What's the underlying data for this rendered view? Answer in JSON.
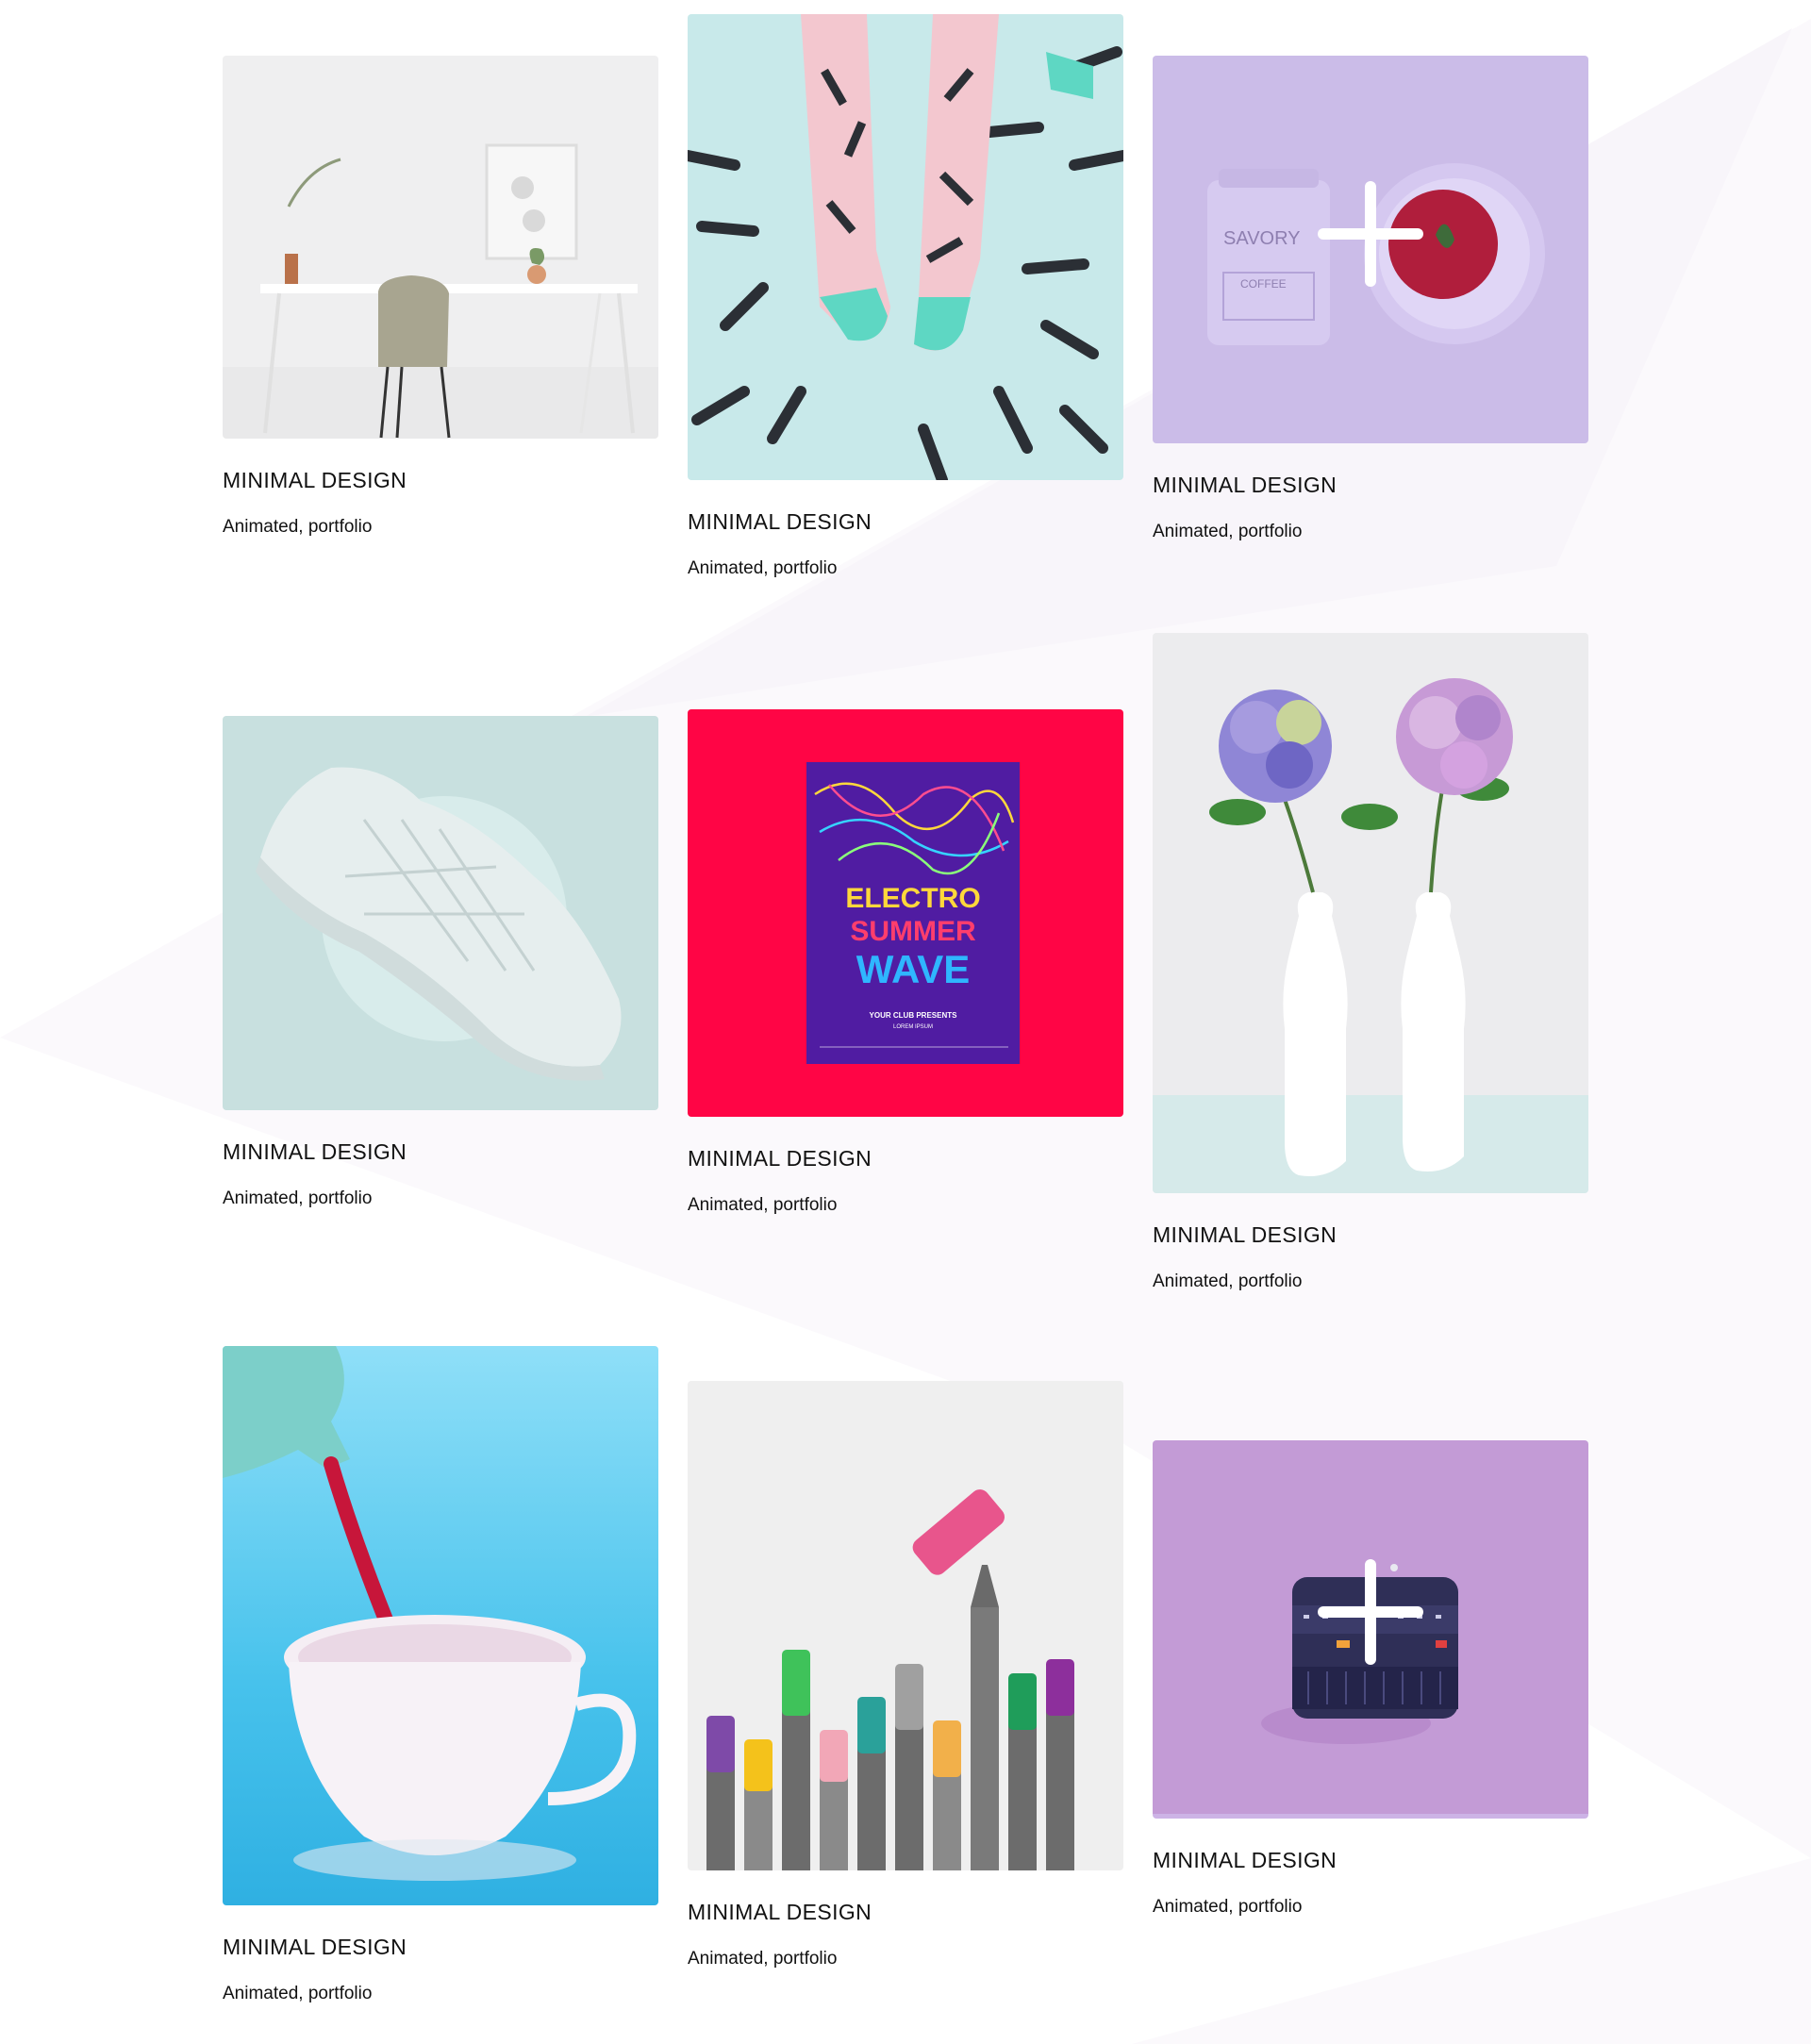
{
  "colors": {
    "page_bg": "#ffffff",
    "shape_bg": "#fbf9fc",
    "text": "#111111"
  },
  "portfolio": {
    "items": [
      {
        "title": "MINIMAL DESIGN",
        "tags": "Animated, portfolio",
        "image": "desk-chair-photo",
        "bg": "#efeff0"
      },
      {
        "title": "MINIMAL DESIGN",
        "tags": "Animated, portfolio",
        "image": "patterned-socks-photo",
        "bg": "#c8e9ea"
      },
      {
        "title": "MINIMAL DESIGN",
        "tags": "Animated, portfolio",
        "image": "coffee-can-and-soup-photo",
        "bg": "#cbbce8",
        "hover_icon": "plus-icon"
      },
      {
        "title": "MINIMAL DESIGN",
        "tags": "Animated, portfolio",
        "image": "white-sneaker-photo",
        "bg": "#c8e0df"
      },
      {
        "title": "MINIMAL DESIGN",
        "tags": "Animated, portfolio",
        "image": "electro-poster-photo",
        "bg": "#ff0545"
      },
      {
        "title": "MINIMAL DESIGN",
        "tags": "Animated, portfolio",
        "image": "hydrangea-vases-photo",
        "bg": "#ececee"
      },
      {
        "title": "MINIMAL DESIGN",
        "tags": "Animated, portfolio",
        "image": "teapot-and-cup-photo",
        "bg": "#5ccbec"
      },
      {
        "title": "MINIMAL DESIGN",
        "tags": "Animated, portfolio",
        "image": "markers-photo",
        "bg": "#efefef"
      },
      {
        "title": "MINIMAL DESIGN",
        "tags": "Animated, portfolio",
        "image": "camera-lens-photo",
        "bg": "#c39bd6",
        "hover_icon": "plus-icon"
      }
    ]
  },
  "poster": {
    "line1": "ELECTRO",
    "line2": "SUMMER",
    "line3": "WAVE",
    "subtitle": "YOUR CLUB PRESENTS",
    "subtitle2": "LOREM IPSUM"
  },
  "coffee_can": {
    "brand": "SAVORY",
    "label": "COFFEE"
  }
}
